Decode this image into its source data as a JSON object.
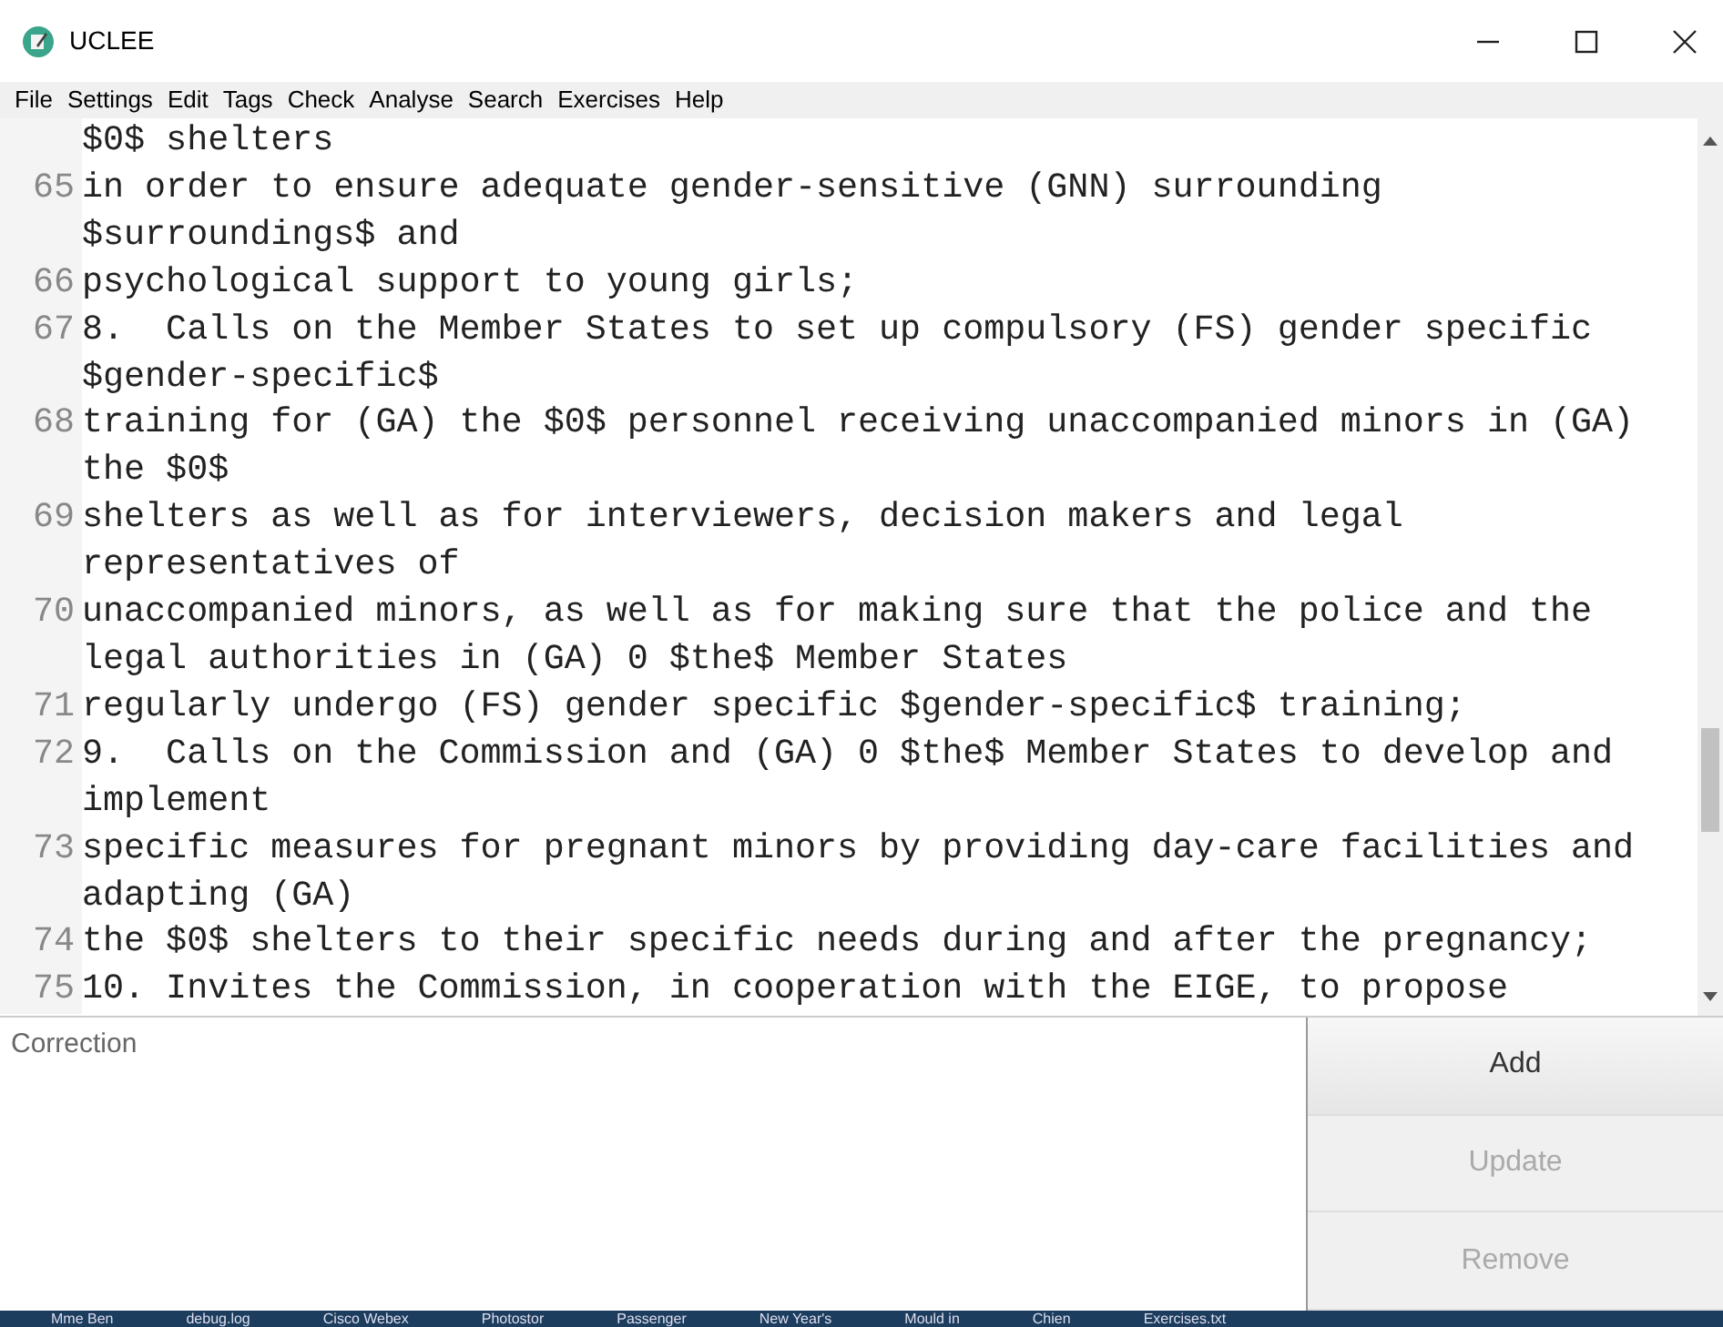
{
  "window": {
    "title": "UCLEE"
  },
  "menu": [
    "File",
    "Settings",
    "Edit",
    "Tags",
    "Check",
    "Analyse",
    "Search",
    "Exercises",
    "Help"
  ],
  "lines": [
    {
      "rows": [
        "$0$ shelters"
      ]
    },
    {
      "number": "65",
      "rows": [
        "in order to ensure adequate gender-sensitive (GNN) surrounding",
        "$surroundings$ and"
      ]
    },
    {
      "number": "66",
      "rows": [
        "psychological support to young girls;"
      ]
    },
    {
      "number": "67",
      "rows": [
        "8.  Calls on the Member States to set up compulsory (FS) gender specific",
        "$gender-specific$"
      ]
    },
    {
      "number": "68",
      "rows": [
        "training for (GA) the $0$ personnel receiving unaccompanied minors in (GA)",
        "the $0$"
      ]
    },
    {
      "number": "69",
      "rows": [
        "shelters as well as for interviewers, decision makers and legal",
        "representatives of"
      ]
    },
    {
      "number": "70",
      "rows": [
        "unaccompanied minors, as well as for making sure that the police and the",
        "legal authorities in (GA) 0 $the$ Member States"
      ]
    },
    {
      "number": "71",
      "rows": [
        "regularly undergo (FS) gender specific $gender-specific$ training;"
      ]
    },
    {
      "number": "72",
      "rows": [
        "9.  Calls on the Commission and (GA) 0 $the$ Member States to develop and",
        "implement"
      ]
    },
    {
      "number": "73",
      "rows": [
        "specific measures for pregnant minors by providing day-care facilities and",
        "adapting (GA)"
      ]
    },
    {
      "number": "74",
      "rows": [
        "the $0$ shelters to their specific needs during and after the pregnancy;"
      ]
    },
    {
      "number": "75",
      "rows": [
        "10. Invites the Commission, in cooperation with the EIGE, to propose"
      ]
    }
  ],
  "correction": {
    "placeholder": "Correction"
  },
  "buttons": [
    {
      "label": "Add",
      "disabled": false
    },
    {
      "label": "Update",
      "disabled": true
    },
    {
      "label": "Remove",
      "disabled": true
    }
  ],
  "taskbar": [
    "Mme Ben",
    "debug.log",
    "Cisco Webex",
    "Photostor",
    "Passenger",
    "New Year's",
    "Mould in",
    "Chien",
    "Exercises.txt"
  ]
}
